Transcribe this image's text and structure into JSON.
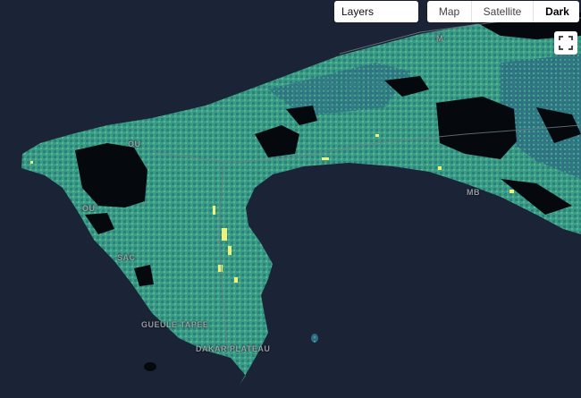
{
  "controls": {
    "layers_label": "Layers",
    "modes": [
      "Map",
      "Satellite",
      "Dark"
    ],
    "active_mode": "Dark",
    "fullscreen_icon": "fullscreen-icon"
  },
  "map": {
    "colors": {
      "water": "#1b2436",
      "unpopulated_land": "#05080d",
      "density_low": "#2d5a7a",
      "density_mid": "#3aa38a",
      "density_high": "#7fd07a",
      "density_peak": "#f2f27a"
    },
    "labels": {
      "ouakam": "OU",
      "yoff": "OU",
      "sacre_coeur": "SAC",
      "gueule_tapee": "GUEULE TAPEE",
      "dakar_plateau": "DAKAR PLATEAU",
      "mbao": "MB",
      "ngor": "MB",
      "top_label": "M"
    }
  }
}
